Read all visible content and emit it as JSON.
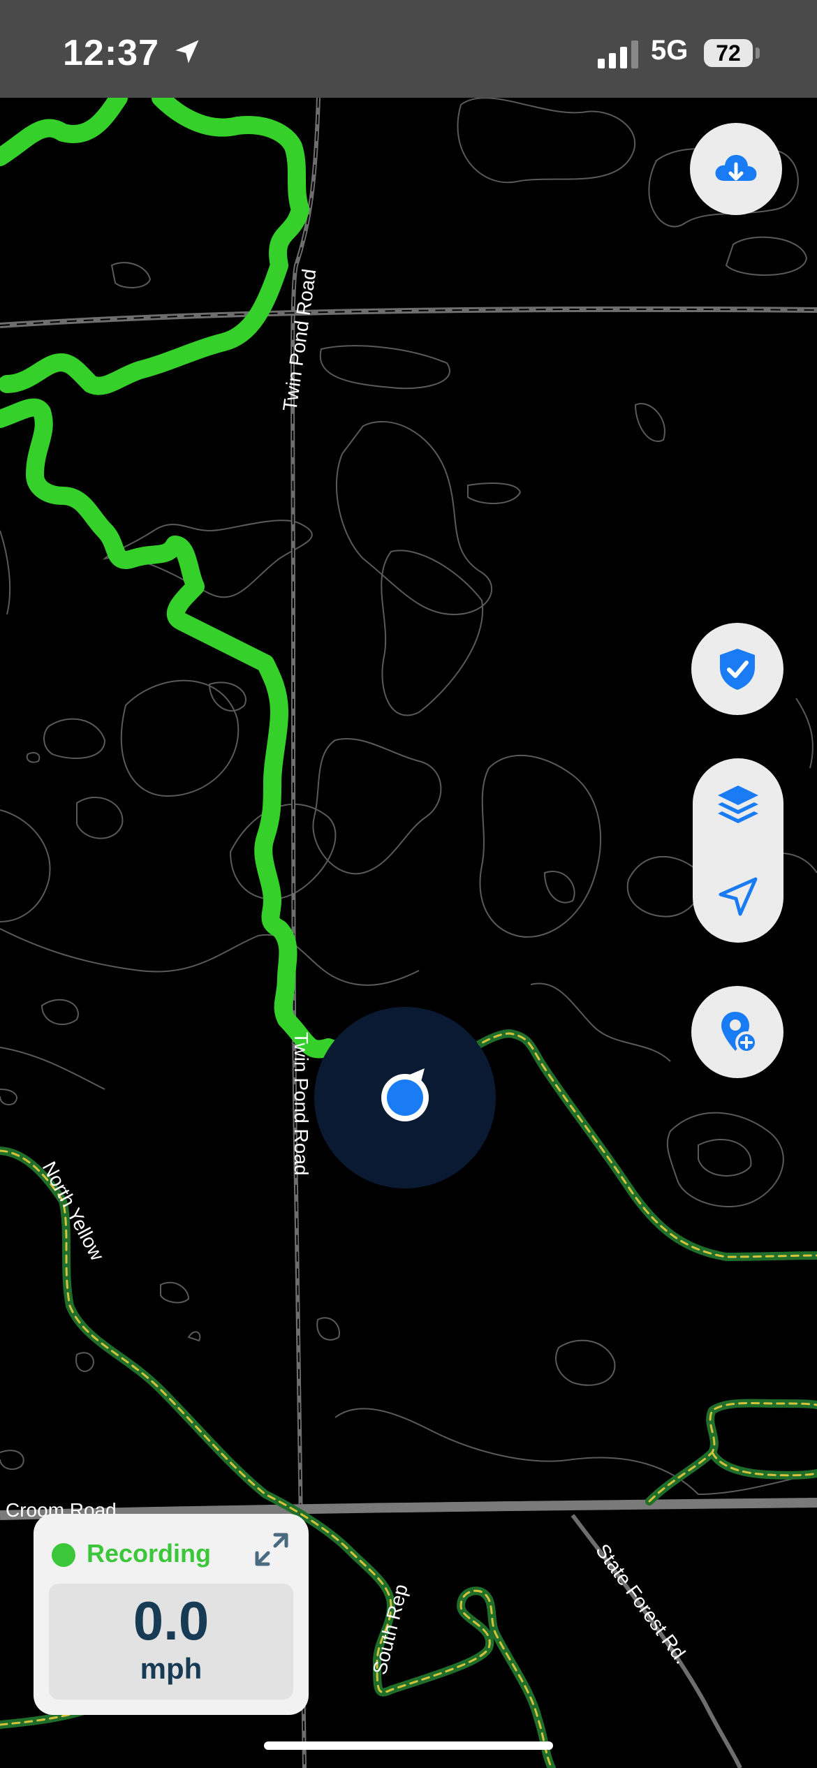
{
  "status_bar": {
    "time": "12:37",
    "network": "5G",
    "battery": "72",
    "location_icon": "location-arrow-icon",
    "signal_icon": "cellular-signal-icon"
  },
  "map": {
    "road_labels": {
      "twin_pond_upper": "Twin Pond Road",
      "twin_pond_lower": "Twin Pond Road",
      "north_yellow": "North Yellow",
      "croom_road": "Croom Road",
      "south_rep": "South Rep",
      "state_forest": "State Forest Rd."
    },
    "colors": {
      "recorded_track": "#35d12a",
      "trail_outline": "#1f6e2a",
      "trail_dash": "#d4c23c",
      "contour": "#5a5a5a",
      "road": "#6e6e6e",
      "user_location": "#1a7cf5",
      "accuracy_halo": "#0b1a33"
    }
  },
  "controls": {
    "download_button": {
      "icon": "cloud-download-icon"
    },
    "safety_button": {
      "icon": "shield-check-icon"
    },
    "layers_button": {
      "icon": "layers-icon"
    },
    "locate_button": {
      "icon": "navigation-arrow-icon"
    },
    "add_waypoint_button": {
      "icon": "pin-plus-icon"
    }
  },
  "recording": {
    "status": "Recording",
    "speed_value": "0.0",
    "speed_unit": "mph",
    "status_color": "#3cc63a",
    "expand_icon": "expand-arrows-icon"
  }
}
